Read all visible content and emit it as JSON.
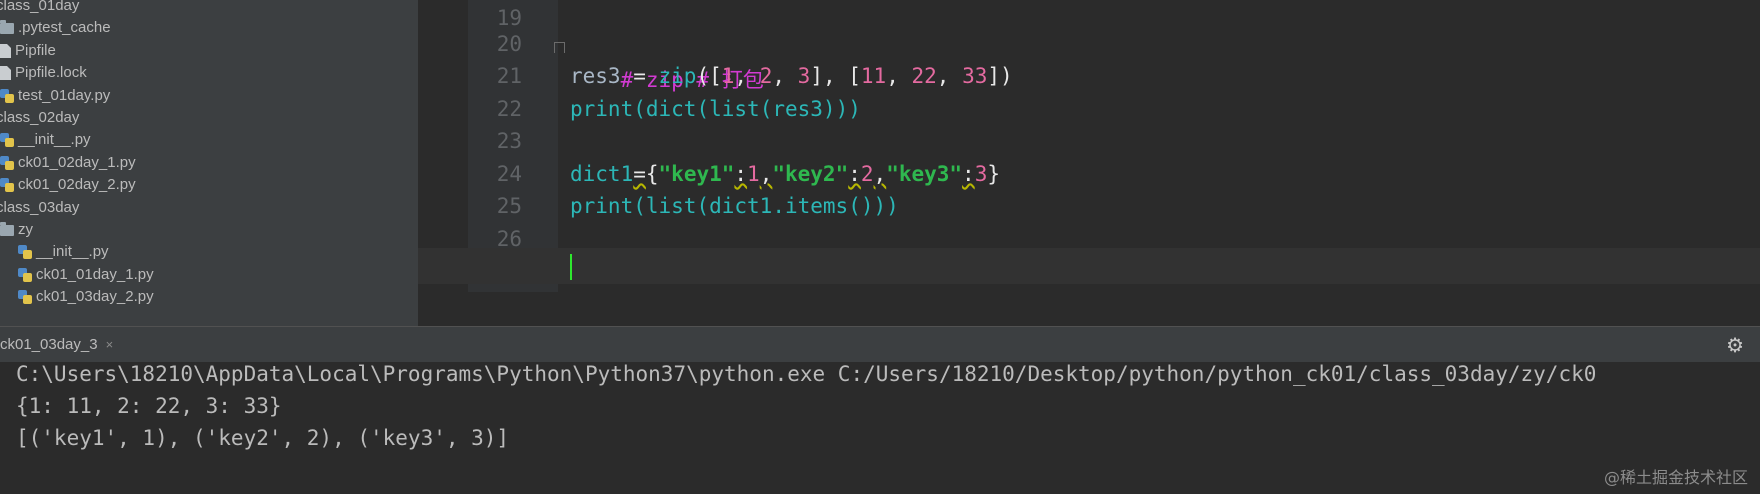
{
  "tree": [
    {
      "label": "class_01day",
      "kind": "folder",
      "indent": 0
    },
    {
      "label": ".pytest_cache",
      "kind": "folder",
      "indent": 1
    },
    {
      "label": "Pipfile",
      "kind": "file",
      "indent": 1
    },
    {
      "label": "Pipfile.lock",
      "kind": "file",
      "indent": 1
    },
    {
      "label": "test_01day.py",
      "kind": "py",
      "indent": 1
    },
    {
      "label": "class_02day",
      "kind": "folder",
      "indent": 0
    },
    {
      "label": "__init__.py",
      "kind": "py",
      "indent": 1
    },
    {
      "label": "ck01_02day_1.py",
      "kind": "py",
      "indent": 1
    },
    {
      "label": "ck01_02day_2.py",
      "kind": "py",
      "indent": 1
    },
    {
      "label": "class_03day",
      "kind": "folder",
      "indent": 0
    },
    {
      "label": "zy",
      "kind": "folder",
      "indent": 1
    },
    {
      "label": "__init__.py",
      "kind": "py",
      "indent": 2
    },
    {
      "label": "ck01_01day_1.py",
      "kind": "py",
      "indent": 2
    },
    {
      "label": "ck01_03day_2.py",
      "kind": "py",
      "indent": 2
    }
  ],
  "editor": {
    "line_numbers": [
      "19",
      "20",
      "21",
      "22",
      "23",
      "24",
      "25",
      "26"
    ],
    "line20": {
      "comment": "# zip # 打包"
    },
    "line21": {
      "var": "res3 ",
      "eq": "= ",
      "fn": "zip",
      "p1": "([",
      "n1": "1",
      "c1": ", ",
      "n2": "2",
      "c2": ", ",
      "n3": "3",
      "p2": "], [",
      "n4": "11",
      "c3": ", ",
      "n5": "22",
      "c4": ", ",
      "n6": "33",
      "p3": "])"
    },
    "line22": {
      "fn1": "print",
      "p1": "(",
      "fn2": "dict",
      "p2": "(",
      "fn3": "list",
      "p3": "(",
      "var": "res3",
      "p4": ")))"
    },
    "line24": {
      "var": "dict1",
      "eq": "=",
      "b1": "{",
      "s1": "\"key1\"",
      "col1": ":",
      "n1": "1",
      "cm1": ",",
      "s2": "\"key2\"",
      "col2": ":",
      "n2": "2",
      "cm2": ",",
      "s3": "\"key3\"",
      "col3": ":",
      "n3": "3",
      "b2": "}"
    },
    "line25": {
      "fn1": "print",
      "p1": "(",
      "fn2": "list",
      "p2": "(",
      "var": "dict1.items",
      "p3": "()))"
    }
  },
  "run": {
    "tab_label": "ck01_03day_3",
    "close": "×",
    "gear": "⚙",
    "output": [
      "C:\\Users\\18210\\AppData\\Local\\Programs\\Python\\Python37\\python.exe C:/Users/18210/Desktop/python/python_ck01/class_03day/zy/ck0",
      "{1: 11, 2: 22, 3: 33}",
      "[('key1', 1), ('key2', 2), ('key3', 3)]"
    ]
  },
  "watermark": "@稀土掘金技术社区"
}
